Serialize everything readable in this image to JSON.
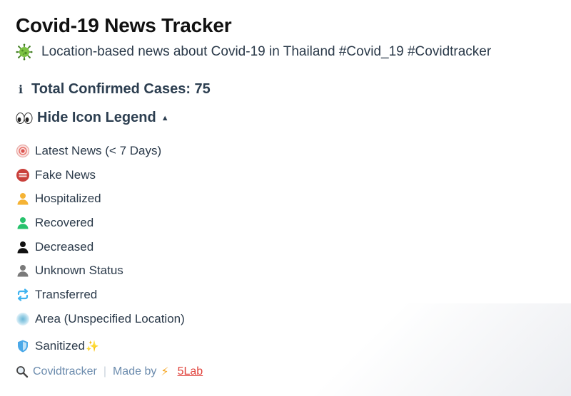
{
  "header": {
    "title": "Covid-19 News Tracker",
    "subtitle": "Location-based news about Covid-19 in Thailand #Covid_19 #Covidtracker"
  },
  "stats": {
    "total_label": "Total Confirmed Cases: 75"
  },
  "legend": {
    "toggle_label": "Hide Icon Legend",
    "items": [
      {
        "label": "Latest News (< 7 Days)",
        "icon": "latest-news-icon"
      },
      {
        "label": "Fake News",
        "icon": "fake-news-icon"
      },
      {
        "label": "Hospitalized",
        "icon": "person-orange-icon"
      },
      {
        "label": "Recovered",
        "icon": "person-green-icon"
      },
      {
        "label": "Decreased",
        "icon": "person-black-icon"
      },
      {
        "label": "Unknown Status",
        "icon": "person-gray-icon"
      },
      {
        "label": "Transferred",
        "icon": "transfer-icon"
      },
      {
        "label": "Area (Unspecified Location)",
        "icon": "area-icon"
      },
      {
        "label": "Sanitized",
        "icon": "shield-icon"
      }
    ]
  },
  "footer": {
    "link_label": "Covidtracker",
    "made_by": "Made by",
    "lab_label": "5Lab"
  },
  "colors": {
    "hospitalized": "#f5b335",
    "recovered": "#27c26c",
    "decreased": "#111111",
    "unknown": "#7a7a7a",
    "transfer": "#3fb3f0",
    "fake": "#d9534f",
    "link": "#6b8bad",
    "lab": "#e0413a"
  }
}
